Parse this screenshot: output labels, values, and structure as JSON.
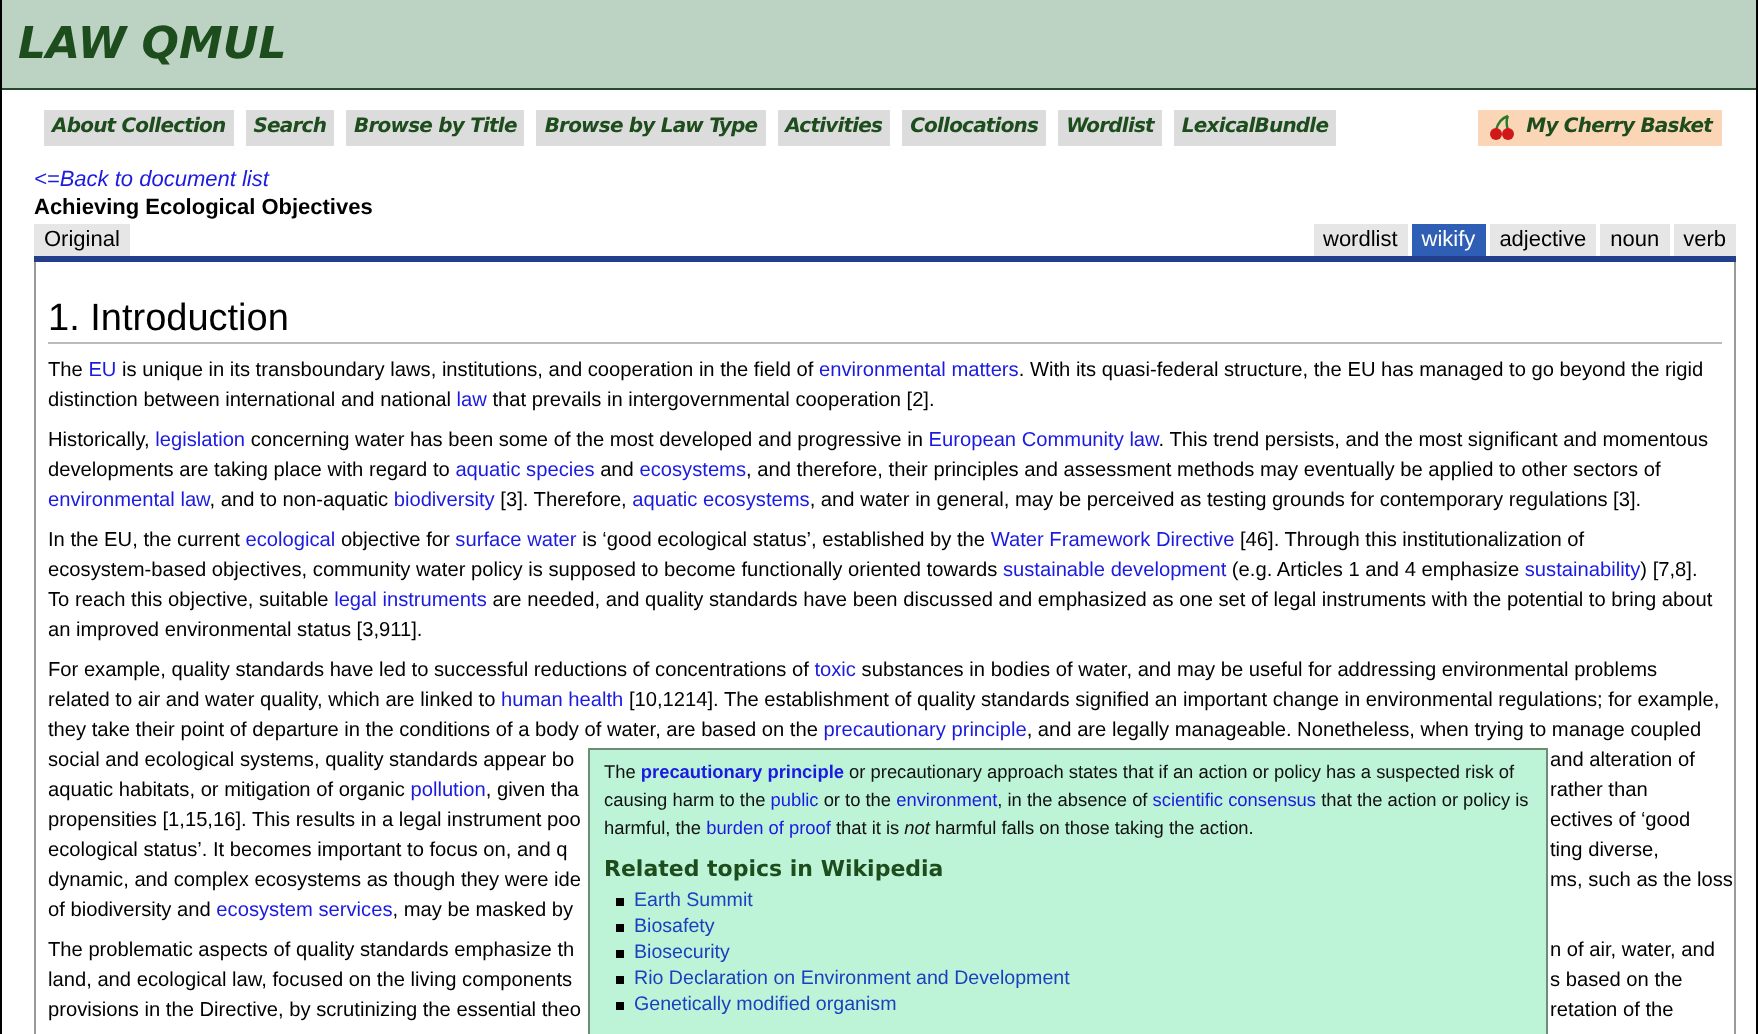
{
  "site_title": "LAW QMUL",
  "nav": [
    {
      "label": "About Collection"
    },
    {
      "label": "Search"
    },
    {
      "label": "Browse by Title"
    },
    {
      "label": "Browse by Law Type"
    },
    {
      "label": "Activities"
    },
    {
      "label": "Collocations"
    },
    {
      "label": "Wordlist"
    },
    {
      "label": "LexicalBundle"
    }
  ],
  "basket": {
    "label": "My Cherry Basket"
  },
  "back_link": "<=Back to document list",
  "document_title": "Achieving Ecological Objectives",
  "left_tabs": [
    {
      "label": "Original",
      "selected": false
    }
  ],
  "right_tabs": [
    {
      "label": "wordlist",
      "selected": false
    },
    {
      "label": "wikify",
      "selected": true
    },
    {
      "label": "adjective",
      "selected": false
    },
    {
      "label": "noun",
      "selected": false
    },
    {
      "label": "verb",
      "selected": false
    }
  ],
  "heading": "1. Introduction",
  "paragraphs": [
    {
      "lines": [
        {
          "kind": "full",
          "segments": [
            {
              "kind": "plain",
              "text": "The "
            },
            {
              "kind": "link",
              "text": "EU"
            },
            {
              "kind": "plain",
              "text": " is unique in its transboundary laws, institutions, and cooperation in the field of "
            },
            {
              "kind": "link",
              "text": "environmental matters"
            },
            {
              "kind": "plain",
              "text": ". With its quasi-federal structure, the EU has managed to go beyond the rigid"
            }
          ]
        },
        {
          "kind": "full",
          "segments": [
            {
              "kind": "plain",
              "text": "distinction between international and national "
            },
            {
              "kind": "link",
              "text": "law"
            },
            {
              "kind": "plain",
              "text": " that prevails in intergovernmental cooperation [2]."
            }
          ]
        }
      ]
    },
    {
      "lines": [
        {
          "kind": "full",
          "segments": [
            {
              "kind": "plain",
              "text": "Historically, "
            },
            {
              "kind": "link",
              "text": "legislation"
            },
            {
              "kind": "plain",
              "text": " concerning water has been some of the most developed and progressive in "
            },
            {
              "kind": "link",
              "text": "European Community law"
            },
            {
              "kind": "plain",
              "text": ". This trend persists, and the most significant and momentous"
            }
          ]
        },
        {
          "kind": "full",
          "segments": [
            {
              "kind": "plain",
              "text": "developments are taking place with regard to "
            },
            {
              "kind": "link",
              "text": "aquatic species"
            },
            {
              "kind": "plain",
              "text": " and "
            },
            {
              "kind": "link",
              "text": "ecosystems"
            },
            {
              "kind": "plain",
              "text": ", and therefore, their principles and assessment methods may eventually be applied to other sectors of"
            }
          ]
        },
        {
          "kind": "full",
          "segments": [
            {
              "kind": "link",
              "text": "environmental law"
            },
            {
              "kind": "plain",
              "text": ", and to non-aquatic "
            },
            {
              "kind": "link",
              "text": "biodiversity"
            },
            {
              "kind": "plain",
              "text": " [3]. Therefore, "
            },
            {
              "kind": "link",
              "text": "aquatic ecosystems"
            },
            {
              "kind": "plain",
              "text": ", and water in general, may be perceived as testing grounds for contemporary regulations [3]."
            }
          ]
        }
      ]
    },
    {
      "lines": [
        {
          "kind": "full",
          "segments": [
            {
              "kind": "plain",
              "text": "In the EU, the current "
            },
            {
              "kind": "link",
              "text": "ecological"
            },
            {
              "kind": "plain",
              "text": " objective for "
            },
            {
              "kind": "link",
              "text": "surface water"
            },
            {
              "kind": "plain",
              "text": " is ‘good ecological status’, established by the "
            },
            {
              "kind": "link",
              "text": "Water Framework Directive"
            },
            {
              "kind": "plain",
              "text": " [46]. Through this institutionalization of"
            }
          ]
        },
        {
          "kind": "full",
          "segments": [
            {
              "kind": "plain",
              "text": "ecosystem-based objectives, community water policy is supposed to become functionally oriented towards "
            },
            {
              "kind": "link",
              "text": "sustainable development"
            },
            {
              "kind": "plain",
              "text": " (e.g. Articles 1 and 4 emphasize "
            },
            {
              "kind": "link",
              "text": "sustainability"
            },
            {
              "kind": "plain",
              "text": ") [7,8]."
            }
          ]
        },
        {
          "kind": "full",
          "segments": [
            {
              "kind": "plain",
              "text": "To reach this objective, suitable "
            },
            {
              "kind": "link",
              "text": "legal instruments"
            },
            {
              "kind": "plain",
              "text": " are needed, and quality standards have been discussed and emphasized as one set of legal instruments with the potential to bring about"
            }
          ]
        },
        {
          "kind": "full",
          "segments": [
            {
              "kind": "plain",
              "text": "an improved environmental status [3,911]."
            }
          ]
        }
      ]
    },
    {
      "lines": [
        {
          "kind": "full",
          "segments": [
            {
              "kind": "plain",
              "text": "For example, quality standards have led to successful reductions of concentrations of "
            },
            {
              "kind": "link",
              "text": "toxic"
            },
            {
              "kind": "plain",
              "text": " substances in bodies of water, and may be useful for addressing environmental problems"
            }
          ]
        },
        {
          "kind": "full",
          "segments": [
            {
              "kind": "plain",
              "text": "related to air and water quality, which are linked to "
            },
            {
              "kind": "link",
              "text": "human health"
            },
            {
              "kind": "plain",
              "text": " [10,1214]. The establishment of quality standards signified an important change in environmental regulations; for example,"
            }
          ]
        },
        {
          "kind": "full",
          "segments": [
            {
              "kind": "plain",
              "text": "they take their point of departure in the conditions of a body of water, are based on the "
            },
            {
              "kind": "link",
              "text": "precautionary principle"
            },
            {
              "kind": "plain",
              "text": ", and are legally manageable. Nonetheless, when trying to manage coupled"
            }
          ]
        },
        {
          "kind": "split",
          "left": [
            {
              "kind": "plain",
              "text": "social and ecological systems, quality standards appear bo"
            }
          ],
          "right": [
            {
              "kind": "plain",
              "text": "and alteration of"
            }
          ]
        },
        {
          "kind": "split",
          "left": [
            {
              "kind": "plain",
              "text": "aquatic habitats, or mitigation of organic "
            },
            {
              "kind": "link",
              "text": "pollution"
            },
            {
              "kind": "plain",
              "text": ", given tha"
            }
          ],
          "right": [
            {
              "kind": "plain",
              "text": "rather than"
            }
          ]
        },
        {
          "kind": "split",
          "left": [
            {
              "kind": "plain",
              "text": "propensities [1,15,16]. This results in a legal instrument poo"
            }
          ],
          "right": [
            {
              "kind": "plain",
              "text": "ectives of ‘good"
            }
          ]
        },
        {
          "kind": "split",
          "left": [
            {
              "kind": "plain",
              "text": "ecological status’. It becomes important to focus on, and q"
            }
          ],
          "right": [
            {
              "kind": "plain",
              "text": "ting diverse,"
            }
          ]
        },
        {
          "kind": "split",
          "left": [
            {
              "kind": "plain",
              "text": "dynamic, and complex ecosystems as though they were ide"
            }
          ],
          "right": [
            {
              "kind": "plain",
              "text": "ms, such as the loss"
            }
          ]
        },
        {
          "kind": "split",
          "left": [
            {
              "kind": "plain",
              "text": "of biodiversity and "
            },
            {
              "kind": "link",
              "text": "ecosystem services"
            },
            {
              "kind": "plain",
              "text": ", may be masked by"
            }
          ]
        }
      ]
    },
    {
      "lines": [
        {
          "kind": "split",
          "left": [
            {
              "kind": "plain",
              "text": "The problematic aspects of quality standards emphasize th"
            }
          ],
          "right": [
            {
              "kind": "plain",
              "text": "n of air, water, and"
            }
          ]
        },
        {
          "kind": "split",
          "left": [
            {
              "kind": "plain",
              "text": "land, and ecological law, focused on the living components"
            }
          ],
          "right": [
            {
              "kind": "plain",
              "text": "s based on the"
            }
          ]
        },
        {
          "kind": "split",
          "left": [
            {
              "kind": "plain",
              "text": "provisions in the Directive, by scrutinizing the essential theo"
            }
          ],
          "right": [
            {
              "kind": "plain",
              "text": "retation of the"
            }
          ]
        }
      ]
    }
  ],
  "popup": {
    "intro": [
      {
        "kind": "plain",
        "text": "The "
      },
      {
        "kind": "strong_link",
        "text": "precautionary principle"
      },
      {
        "kind": "plain",
        "text": " or precautionary approach states that if an action or policy has a suspected risk of causing harm to the "
      },
      {
        "kind": "link",
        "text": "public"
      },
      {
        "kind": "plain",
        "text": " or to the "
      },
      {
        "kind": "link",
        "text": "environment"
      },
      {
        "kind": "plain",
        "text": ", in the absence of "
      },
      {
        "kind": "link",
        "text": "scientific consensus"
      },
      {
        "kind": "plain",
        "text": " that the action or policy is harmful, the "
      },
      {
        "kind": "link",
        "text": "burden of proof"
      },
      {
        "kind": "plain",
        "text": " that it is "
      },
      {
        "kind": "emphasis",
        "text": "not"
      },
      {
        "kind": "plain",
        "text": " harmful falls on those taking the action."
      }
    ],
    "related_heading": "Related topics in Wikipedia",
    "related": [
      "Earth Summit",
      "Biosafety",
      "Biosecurity",
      "Rio Declaration on Environment and Development",
      "Genetically modified organism"
    ]
  }
}
